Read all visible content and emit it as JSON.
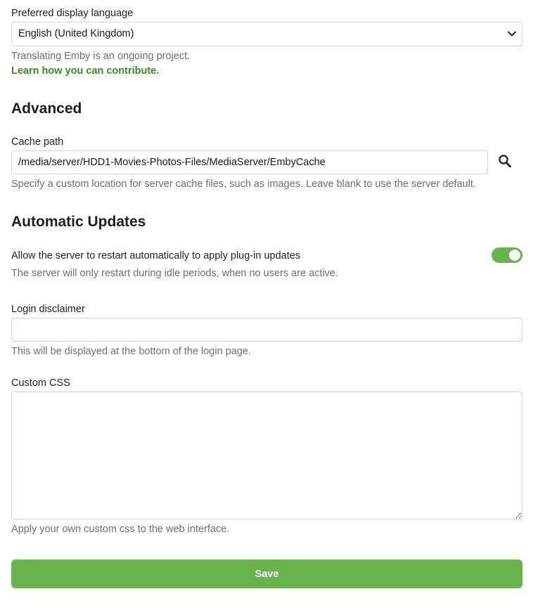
{
  "language": {
    "label": "Preferred display language",
    "selected": "English (United Kingdom)",
    "help": "Translating Emby is an ongoing project.",
    "link": "Learn how you can contribute."
  },
  "advanced": {
    "heading": "Advanced",
    "cache_label": "Cache path",
    "cache_value": "/media/server/HDD1-Movies-Photos-Files/MediaServer/EmbyCache",
    "cache_help": "Specify a custom location for server cache files, such as images. Leave blank to use the server default."
  },
  "updates": {
    "heading": "Automatic Updates",
    "restart_label": "Allow the server to restart automatically to apply plug-in updates",
    "restart_help": "The server will only restart during idle periods, when no users are active.",
    "restart_enabled": true
  },
  "disclaimer": {
    "label": "Login disclaimer",
    "value": "",
    "help": "This will be displayed at the bottom of the login page."
  },
  "css": {
    "label": "Custom CSS",
    "value": "",
    "help": "Apply your own custom css to the web interface."
  },
  "save_label": "Save",
  "icons": {
    "dropdown": "chevron-down-icon",
    "browse": "search-icon"
  },
  "colors": {
    "accent": "#68b34d",
    "link": "#3a8a2c"
  }
}
